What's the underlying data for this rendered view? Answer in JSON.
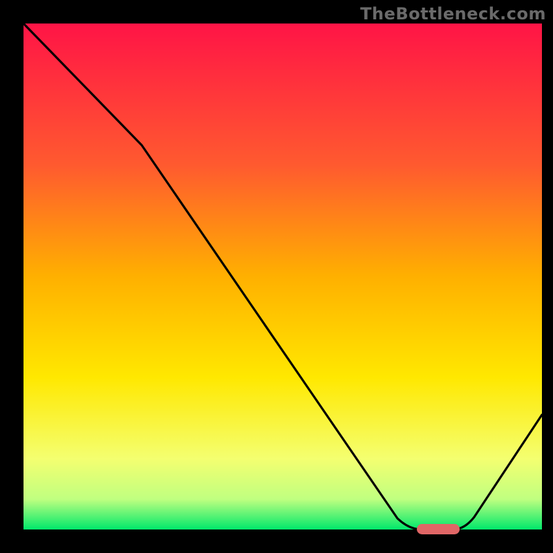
{
  "watermark": "TheBottleneck.com",
  "chart_data": {
    "type": "line",
    "title": "",
    "xlabel": "",
    "ylabel": "",
    "xlim": [
      0,
      100
    ],
    "ylim": [
      0,
      100
    ],
    "x": [
      0,
      22,
      72,
      78,
      84,
      100
    ],
    "values": [
      100,
      76,
      2,
      0,
      0,
      22
    ],
    "optimum_segment": {
      "x_start": 78,
      "x_end": 84,
      "y": 0
    },
    "gradient_stops": [
      {
        "offset": 0.0,
        "color": "#ff1446"
      },
      {
        "offset": 0.28,
        "color": "#ff5a2f"
      },
      {
        "offset": 0.5,
        "color": "#ffb000"
      },
      {
        "offset": 0.7,
        "color": "#ffe800"
      },
      {
        "offset": 0.86,
        "color": "#f4ff70"
      },
      {
        "offset": 0.94,
        "color": "#c0ff80"
      },
      {
        "offset": 1.0,
        "color": "#00e86b"
      }
    ],
    "marker": {
      "color": "#e06666",
      "x_center": 81,
      "y": 0
    }
  }
}
